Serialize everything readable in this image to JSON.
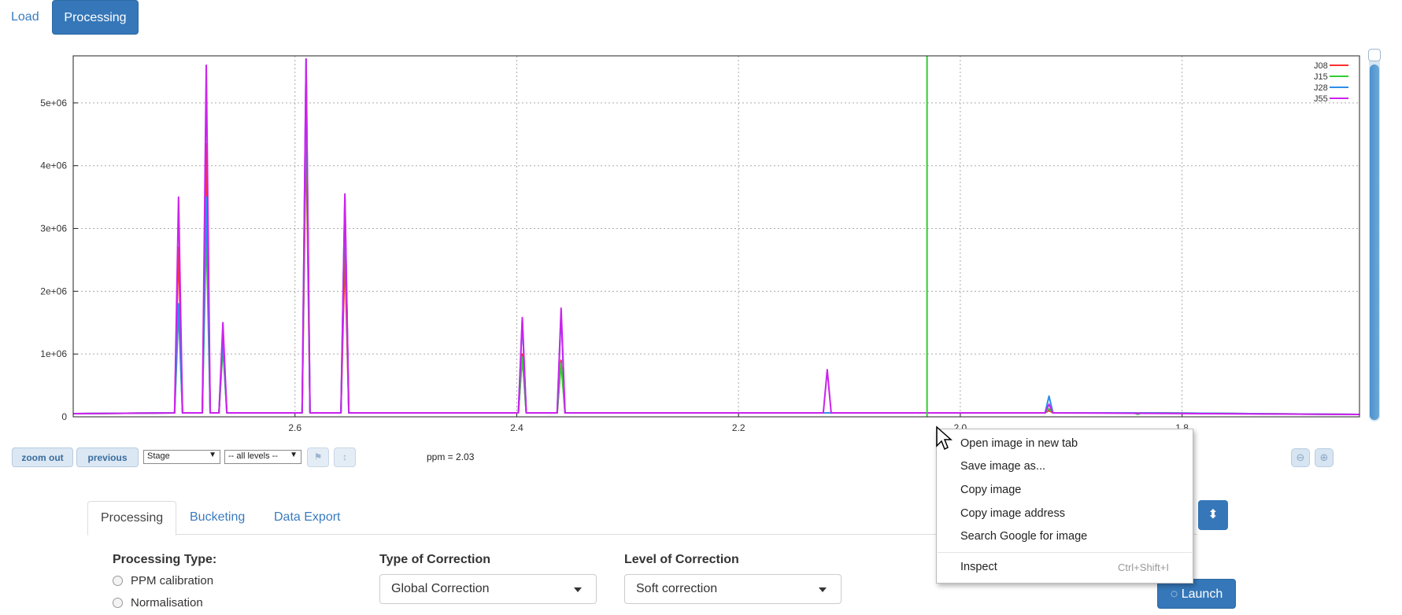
{
  "top_tabs": {
    "load": "Load",
    "processing": "Processing"
  },
  "chart_data": {
    "type": "line",
    "title": "",
    "xlabel": "",
    "ylabel": "",
    "x_reversed": true,
    "xlim": [
      2.8,
      1.64
    ],
    "ylim": [
      0,
      5750000
    ],
    "x_ticks": [
      "2.6",
      "2.4",
      "2.2",
      "2.0",
      "1.8"
    ],
    "y_ticks": [
      "0",
      "1e+06",
      "2e+06",
      "3e+06",
      "4e+06",
      "5e+06"
    ],
    "grid": true,
    "legend": "top-right",
    "cursor_line_ppm": 2.03,
    "colors": {
      "J08": "#ff3030",
      "J15": "#33cc33",
      "J28": "#2e8ee8",
      "J55": "#cc22ee",
      "cursor": "#33cc33"
    },
    "series": [
      {
        "name": "J08",
        "x": [
          2.705,
          2.68,
          2.665,
          2.59,
          2.555,
          2.395,
          2.36,
          1.92,
          1.84
        ],
        "y": [
          2700000,
          4350000,
          1200000,
          4500000,
          2600000,
          1000000,
          900000,
          100000,
          60000
        ]
      },
      {
        "name": "J15",
        "x": [
          2.705,
          2.68,
          2.665,
          2.59,
          2.555,
          2.395,
          2.36,
          1.92,
          1.84
        ],
        "y": [
          1700000,
          3000000,
          1100000,
          5000000,
          3300000,
          950000,
          850000,
          130000,
          40000
        ]
      },
      {
        "name": "J28",
        "x": [
          2.705,
          2.68,
          2.665,
          2.59,
          2.555,
          2.395,
          2.36,
          1.92,
          1.84
        ],
        "y": [
          1800000,
          3500000,
          1300000,
          5700000,
          3500000,
          1550000,
          1650000,
          330000,
          60000
        ]
      },
      {
        "name": "J55",
        "x": [
          2.705,
          2.68,
          2.665,
          2.59,
          2.555,
          2.395,
          2.36,
          2.12,
          1.92
        ],
        "y": [
          3500000,
          5600000,
          1500000,
          5700000,
          3550000,
          1580000,
          1730000,
          750000,
          200000
        ]
      }
    ]
  },
  "toolbar": {
    "zoom_out": "zoom out",
    "previous": "previous",
    "stage_select": "Stage",
    "levels_select": "-- all levels --",
    "ppm_readout": "ppm = 2.03"
  },
  "bottom_tabs": {
    "processing": "Processing",
    "bucketing": "Bucketing",
    "export": "Data Export"
  },
  "form": {
    "processing_type_label": "Processing Type:",
    "radio_ppm": "PPM calibration",
    "radio_norm": "Normalisation",
    "type_correction_label": "Type of Correction",
    "type_correction_value": "Global Correction",
    "level_correction_label": "Level of Correction",
    "level_correction_value": "Soft correction",
    "launch": "Launch"
  },
  "context_menu": {
    "open_new_tab": "Open image in new tab",
    "save_as": "Save image as...",
    "copy_image": "Copy image",
    "copy_address": "Copy image address",
    "search_google": "Search Google for image",
    "inspect": "Inspect",
    "inspect_shortcut": "Ctrl+Shift+I"
  }
}
